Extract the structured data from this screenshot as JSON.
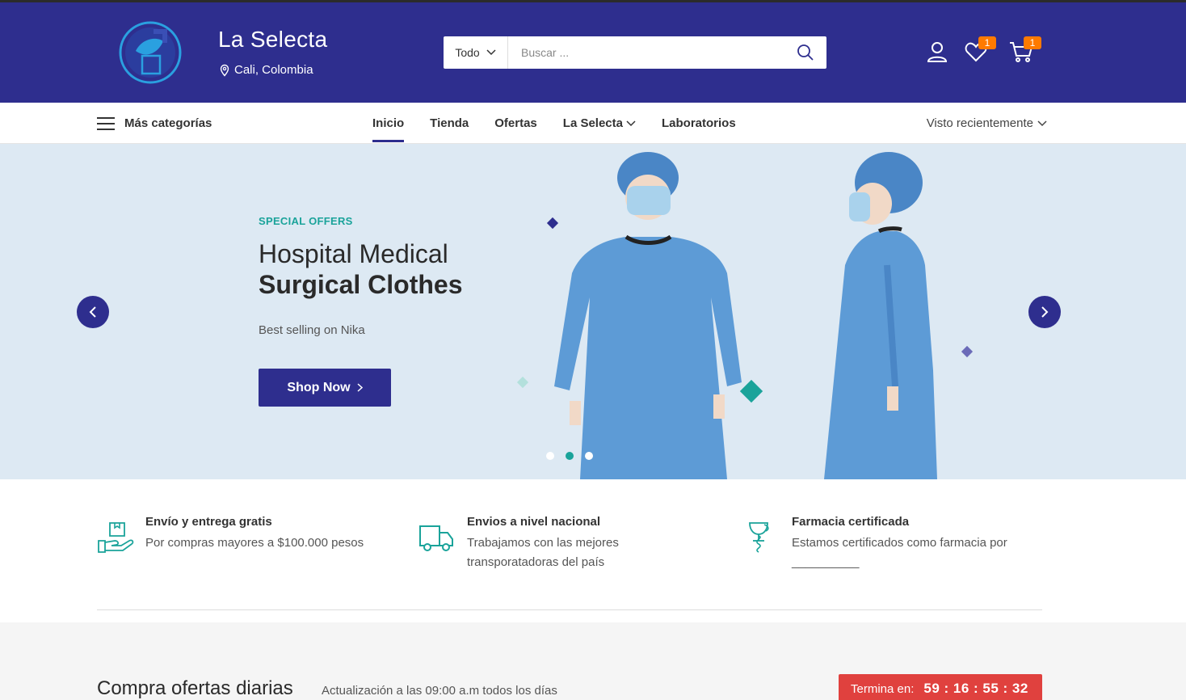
{
  "header": {
    "brand_name": "La Selecta",
    "location": "Cali, Colombia",
    "search": {
      "category": "Todo",
      "placeholder": "Buscar ..."
    },
    "wishlist_count": "1",
    "cart_count": "1"
  },
  "nav": {
    "more_categories": "Más categorías",
    "links": [
      "Inicio",
      "Tienda",
      "Ofertas",
      "La Selecta",
      "Laboratorios"
    ],
    "recently_viewed": "Visto recientemente"
  },
  "hero": {
    "kicker": "SPECIAL OFFERS",
    "title_line1": "Hospital Medical",
    "title_line2": "Surgical Clothes",
    "subtitle": "Best selling on Nika",
    "button": "Shop Now",
    "slide_count": 3,
    "active_slide": 2
  },
  "features": [
    {
      "title": "Envío y entrega gratis",
      "desc1": "Por compras mayores a $100.000 pesos",
      "desc2": "",
      "icon": "hand-package-icon"
    },
    {
      "title": "Envios a nivel nacional",
      "desc1": "Trabajamos con las mejores",
      "desc2": "transporatadoras del país",
      "icon": "truck-icon"
    },
    {
      "title": "Farmacia certificada",
      "desc1": "Estamos certificados como farmacia por",
      "desc2": "__________",
      "icon": "pharmacy-icon"
    }
  ],
  "deals": {
    "title": "Compra ofertas diarias",
    "subtitle": "Actualización a las 09:00 a.m todos los días",
    "countdown_label": "Termina en:",
    "countdown": "59 : 16 : 55 : 32"
  },
  "colors": {
    "primary": "#2e2e8e",
    "accent": "#1aa39a",
    "badge": "#ff7a00",
    "countdown": "#e0413e"
  }
}
